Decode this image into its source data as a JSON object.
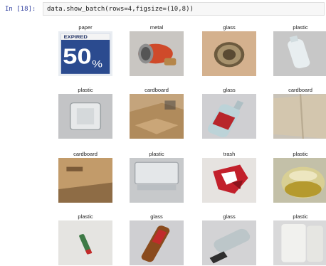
{
  "cell": {
    "prompt": "In [18]:",
    "code": "data.show_batch(rows=4,figsize=(10,8))"
  },
  "grid": {
    "rows": [
      {
        "labels": [
          "paper",
          "metal",
          "glass",
          "plastic"
        ]
      },
      {
        "labels": [
          "plastic",
          "cardboard",
          "glass",
          "cardboard"
        ]
      },
      {
        "labels": [
          "cardboard",
          "plastic",
          "trash",
          "plastic"
        ]
      },
      {
        "labels": [
          "plastic",
          "glass",
          "glass",
          "plastic"
        ]
      }
    ]
  },
  "images": [
    {
      "name": "paper-50-percent-bag"
    },
    {
      "name": "metal-can"
    },
    {
      "name": "glass-jar-lid"
    },
    {
      "name": "plastic-bottle"
    },
    {
      "name": "plastic-container"
    },
    {
      "name": "cardboard-box"
    },
    {
      "name": "glass-bottle-red-label"
    },
    {
      "name": "cardboard-sheet"
    },
    {
      "name": "cardboard-box-open"
    },
    {
      "name": "plastic-tray"
    },
    {
      "name": "trash-crumpled-wrapper"
    },
    {
      "name": "plastic-jar-yellow"
    },
    {
      "name": "plastic-small-tube"
    },
    {
      "name": "glass-bottle-amber"
    },
    {
      "name": "glass-bottle-neck"
    },
    {
      "name": "plastic-white-container"
    }
  ]
}
